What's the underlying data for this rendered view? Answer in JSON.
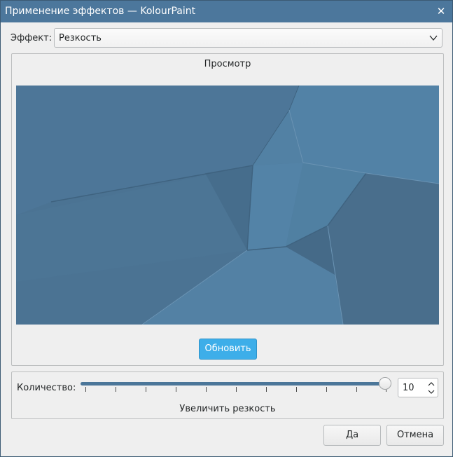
{
  "window": {
    "title": "Применение эффектов — KolourPaint",
    "close_icon": "close-icon"
  },
  "effect": {
    "label": "Эффект:",
    "selected": "Резкость"
  },
  "preview": {
    "title": "Просмотр",
    "refresh_label": "Обновить"
  },
  "amount": {
    "label": "Количество:",
    "value": "10",
    "min": 1,
    "max": 10,
    "slider_fraction": 1.0,
    "description": "Увеличить резкость"
  },
  "buttons": {
    "ok": "Да",
    "cancel": "Отмена"
  },
  "colors": {
    "titlebar": "#4c779c",
    "accent": "#3daee9",
    "preview_base": "#4d7698"
  }
}
